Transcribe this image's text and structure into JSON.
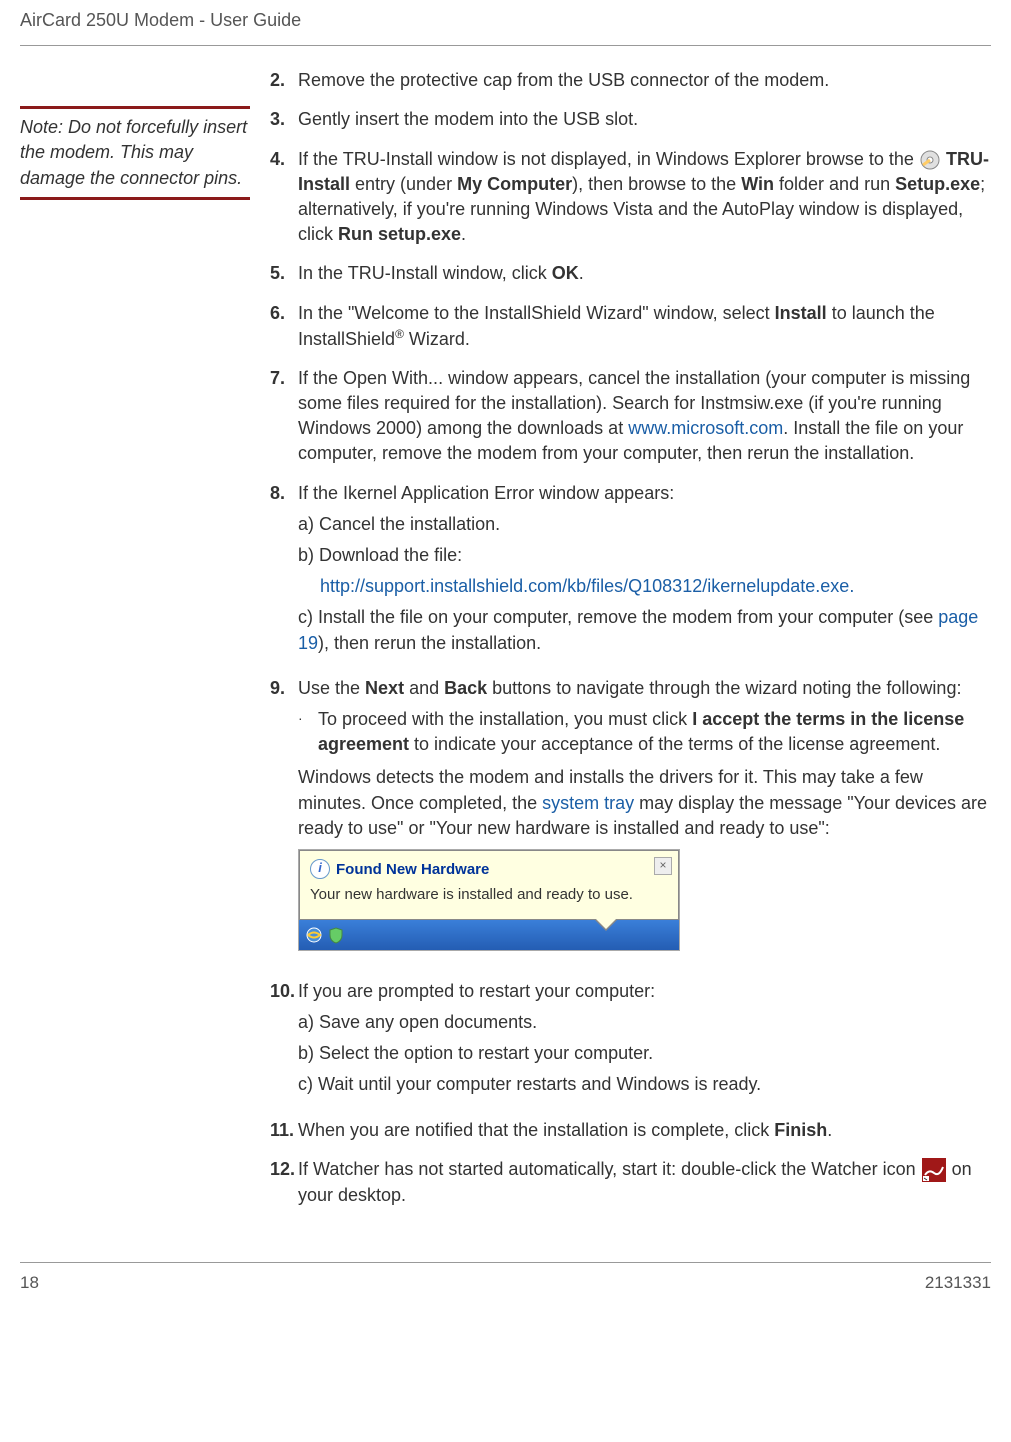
{
  "header": "AirCard 250U Modem - User Guide",
  "sidenote": "Note:  Do not forcefully insert the modem. This may damage the connector pins.",
  "steps": {
    "s2": {
      "num": "2.",
      "text": "Remove the protective cap from the USB connector of the modem."
    },
    "s3": {
      "num": "3.",
      "text": "Gently insert the modem into the USB slot."
    },
    "s4": {
      "num": "4.",
      "pre": "If the TRU-Install window is not displayed, in Windows Explorer browse to the ",
      "tru": "TRU-Install",
      "mid1": " entry (under ",
      "mycomp": "My Computer",
      "mid2": "), then browse to the ",
      "win": "Win",
      "mid3": " folder and run ",
      "setup": "Setup.exe",
      "mid4": "; alternatively, if you're running Windows Vista and the AutoPlay window is displayed, click ",
      "run": "Run setup.exe",
      "end": "."
    },
    "s5": {
      "num": "5.",
      "pre": "In the TRU-Install window, click ",
      "ok": "OK",
      "end": "."
    },
    "s6": {
      "num": "6.",
      "pre": "In the \"Welcome to the InstallShield Wizard\" window, select ",
      "install": "Install",
      "mid": " to launch the InstallShield",
      "reg": "®",
      "end": " Wizard."
    },
    "s7": {
      "num": "7.",
      "pre": "If the Open With... window appears, cancel the installation (your computer is missing some files required for the installation). Search for Instmsiw.exe (if you're running Windows 2000) among the downloads at ",
      "link": "www.microsoft.com",
      "end": ". Install the file on your computer, remove the modem from your computer, then rerun the installation."
    },
    "s8": {
      "num": "8.",
      "text": "If the Ikernel Application Error window appears:",
      "a": "a) Cancel the installation.",
      "b": "b) Download the file:",
      "blink": "http://support.installshield.com/kb/files/Q108312/ikernelupdate.exe.",
      "c_pre": "c) Install the file on your computer, remove the modem from your computer (see ",
      "c_link": "page 19",
      "c_end": "), then rerun the  installation."
    },
    "s9": {
      "num": "9.",
      "pre": "Use the ",
      "next": "Next",
      "mid1": " and ",
      "back": "Back",
      "mid2": " buttons to navigate through the wizard noting the following:",
      "bullet_pre": "To proceed with the installation, you must click ",
      "bullet_bold": "I accept the terms in the license agreement",
      "bullet_end": " to indicate your acceptance of the terms of the license agreement.",
      "para_pre": "Windows detects the modem and installs the drivers for it. This may take a few minutes. Once completed, the ",
      "para_link": "system tray",
      "para_end": " may display the message \"Your devices are ready to use\" or \"Your new hardware is installed and ready to use\":"
    },
    "s10": {
      "num": "10.",
      "text": "If you are prompted to restart your computer:",
      "a": "a) Save any open documents.",
      "b": "b) Select the option to restart your computer.",
      "c": "c) Wait until your computer restarts and Windows is ready."
    },
    "s11": {
      "num": "11.",
      "pre": "When you are notified that the installation is complete, click ",
      "finish": "Finish",
      "end": "."
    },
    "s12": {
      "num": "12.",
      "pre": "If Watcher has not started automatically, start it: double-click the Watcher icon ",
      "end": " on your desktop."
    }
  },
  "found_hw": {
    "title": "Found New Hardware",
    "body": "Your new hardware is installed and ready to use."
  },
  "footer": {
    "page": "18",
    "docnum": "2131331"
  }
}
